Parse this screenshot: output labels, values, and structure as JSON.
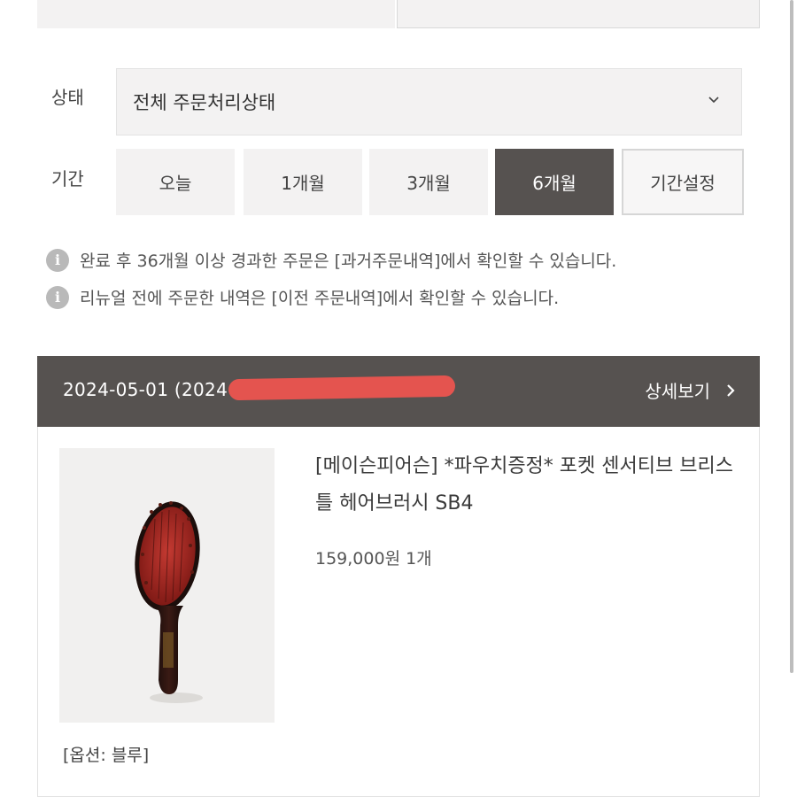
{
  "filters": {
    "status_label": "상태",
    "status_value": "전체 주문처리상태",
    "period_label": "기간",
    "period_options": [
      "오늘",
      "1개월",
      "3개월",
      "6개월",
      "기간설정"
    ],
    "period_selected": "6개월"
  },
  "notices": [
    "완료 후 36개월 이상 경과한 주문은 [과거주문내역]에서 확인할 수 있습니다.",
    "리뉴얼 전에 주문한 내역은 [이전 주문내역]에서 확인할 수 있습니다."
  ],
  "order": {
    "date": "2024-05-01 (2024",
    "detail_label": "상세보기",
    "product": {
      "name": "[메이슨피어슨] *파우치증정* 포켓 센서티브 브리스틀 헤어브러시 SB4",
      "price_qty": "159,000원 1개",
      "option": "[옵션: 블루]"
    }
  },
  "colors": {
    "accent_dark": "#565250",
    "panel_bg": "#f3f2f2",
    "redaction": "#e4544f"
  }
}
